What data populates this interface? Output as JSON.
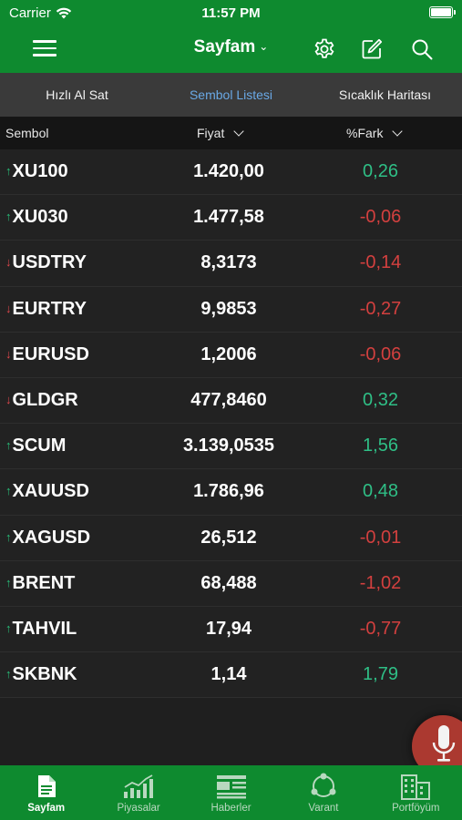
{
  "status_bar": {
    "carrier": "Carrier",
    "time": "11:57 PM"
  },
  "navbar": {
    "title": "Sayfam",
    "title_chevron": "⌄",
    "icons": [
      "menu-icon",
      "gear-icon",
      "edit-icon",
      "search-icon"
    ]
  },
  "segments": [
    {
      "label": "Hızlı Al Sat",
      "active": false
    },
    {
      "label": "Sembol Listesi",
      "active": true
    },
    {
      "label": "Sıcaklık Haritası",
      "active": false
    }
  ],
  "columns": {
    "symbol": "Sembol",
    "price": "Fiyat",
    "diff": "%Fark"
  },
  "rows": [
    {
      "direction": "up",
      "arrow": "↑",
      "symbol": "XU100",
      "price": "1.420,00",
      "diff": "0,26",
      "diff_sign": "pos"
    },
    {
      "direction": "up",
      "arrow": "↑",
      "symbol": "XU030",
      "price": "1.477,58",
      "diff": "-0,06",
      "diff_sign": "neg"
    },
    {
      "direction": "down",
      "arrow": "↓",
      "symbol": "USDTRY",
      "price": "8,3173",
      "diff": "-0,14",
      "diff_sign": "neg"
    },
    {
      "direction": "down",
      "arrow": "↓",
      "symbol": "EURTRY",
      "price": "9,9853",
      "diff": "-0,27",
      "diff_sign": "neg"
    },
    {
      "direction": "down",
      "arrow": "↓",
      "symbol": "EURUSD",
      "price": "1,2006",
      "diff": "-0,06",
      "diff_sign": "neg"
    },
    {
      "direction": "down",
      "arrow": "↓",
      "symbol": "GLDGR",
      "price": "477,8460",
      "diff": "0,32",
      "diff_sign": "pos"
    },
    {
      "direction": "up",
      "arrow": "↑",
      "symbol": "SCUM",
      "price": "3.139,0535",
      "diff": "1,56",
      "diff_sign": "pos"
    },
    {
      "direction": "up",
      "arrow": "↑",
      "symbol": "XAUUSD",
      "price": "1.786,96",
      "diff": "0,48",
      "diff_sign": "pos"
    },
    {
      "direction": "up",
      "arrow": "↑",
      "symbol": "XAGUSD",
      "price": "26,512",
      "diff": "-0,01",
      "diff_sign": "neg"
    },
    {
      "direction": "up",
      "arrow": "↑",
      "symbol": "BRENT",
      "price": "68,488",
      "diff": "-1,02",
      "diff_sign": "neg"
    },
    {
      "direction": "up",
      "arrow": "↑",
      "symbol": "TAHVIL",
      "price": "17,94",
      "diff": "-0,77",
      "diff_sign": "neg"
    },
    {
      "direction": "up",
      "arrow": "↑",
      "symbol": "SKBNK",
      "price": "1,14",
      "diff": "1,79",
      "diff_sign": "pos"
    }
  ],
  "tabbar": [
    {
      "label": "Sayfam",
      "icon": "document-icon",
      "active": true
    },
    {
      "label": "Piyasalar",
      "icon": "chart-icon",
      "active": false
    },
    {
      "label": "Haberler",
      "icon": "news-icon",
      "active": false
    },
    {
      "label": "Varant",
      "icon": "network-icon",
      "active": false
    },
    {
      "label": "Portföyüm",
      "icon": "buildings-icon",
      "active": false
    }
  ],
  "colors": {
    "brand_green": "#0e8a2f",
    "positive": "#2fbf86",
    "negative": "#d3403f",
    "active_segment": "#6aa9e6",
    "mic": "#c43e34"
  }
}
